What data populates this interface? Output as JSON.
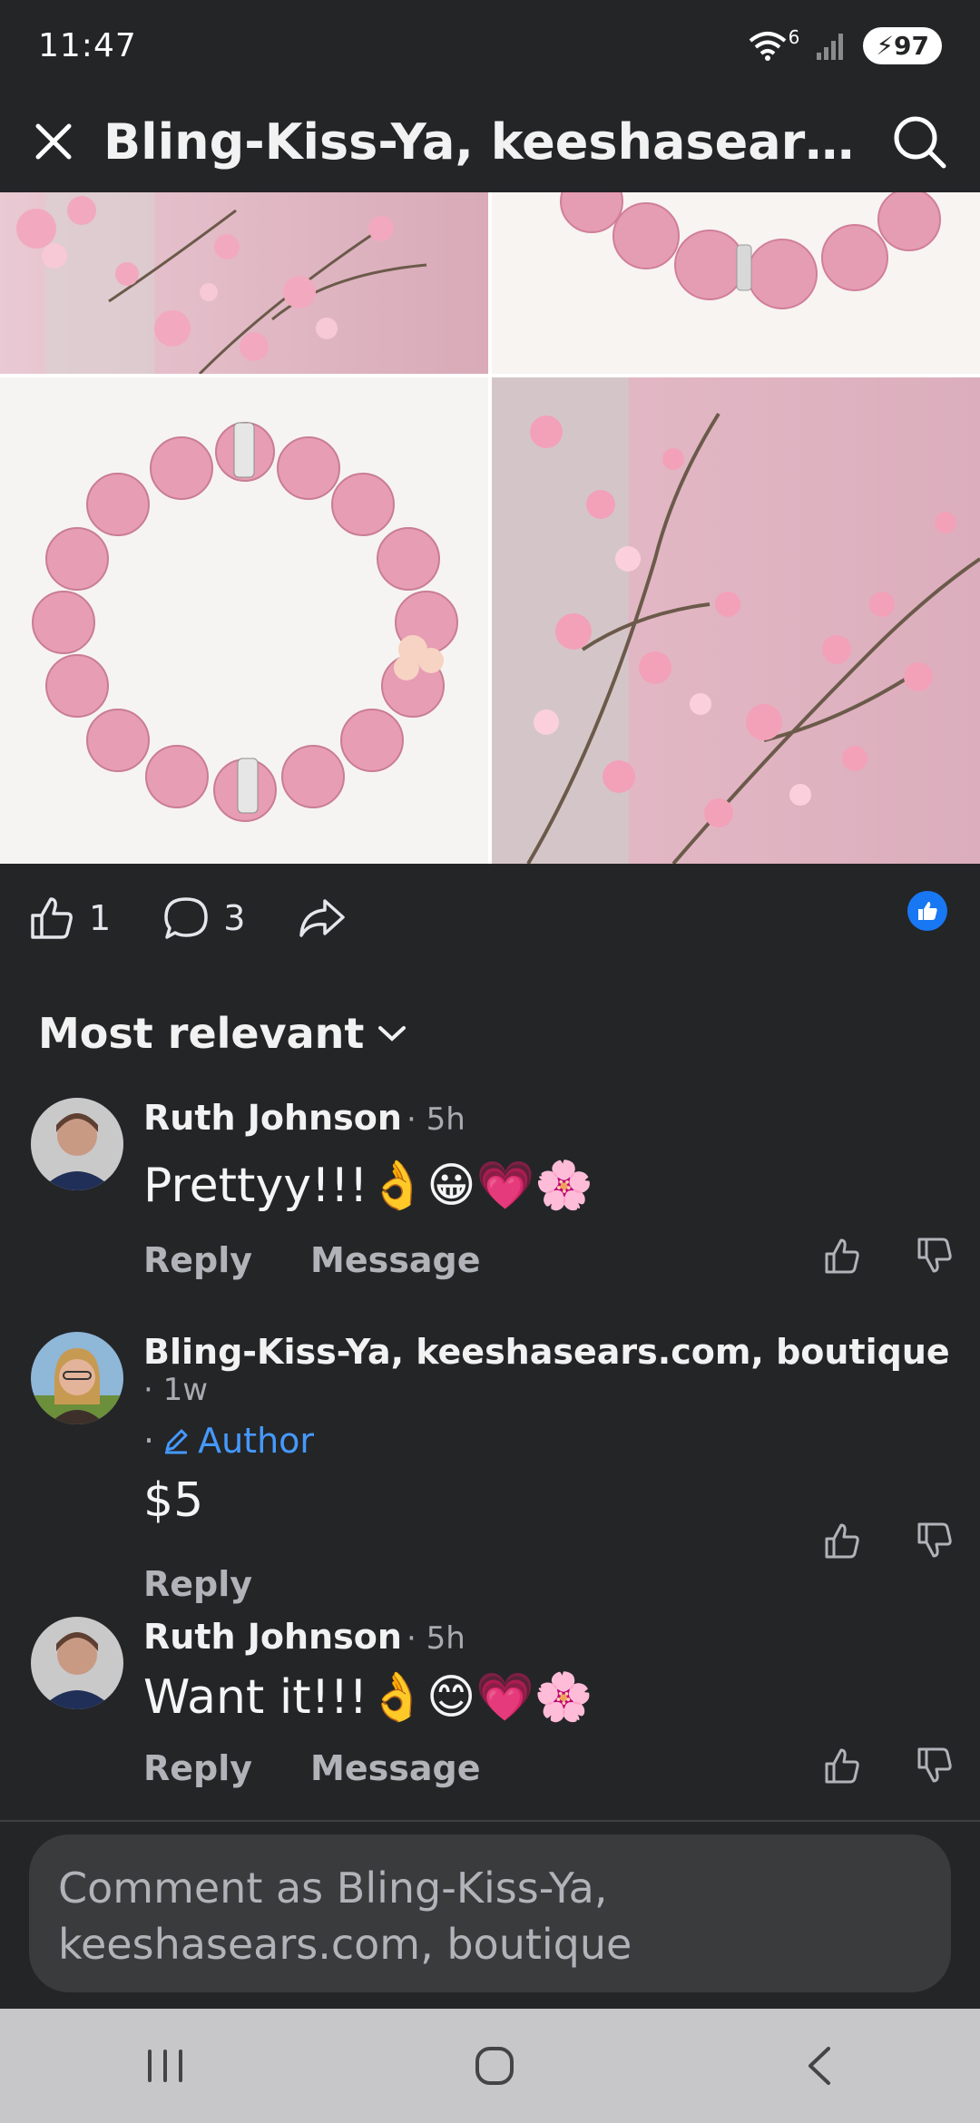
{
  "status": {
    "time": "11:47",
    "battery": "97",
    "wifi_badge": "6"
  },
  "header": {
    "title": "Bling-Kiss-Ya, keeshasears.com,...",
    "close_icon": "close-icon",
    "search_icon": "search-icon"
  },
  "post_actions": {
    "likes": "1",
    "comments": "3"
  },
  "sort": {
    "label": "Most relevant"
  },
  "comments": [
    {
      "name": "Ruth Johnson",
      "time": "· 5h",
      "text": "Prettyy!!!👌😀💗🌸",
      "reply": "Reply",
      "message": "Message"
    },
    {
      "name": "Bling-Kiss-Ya, keeshasears.com, boutique",
      "time": "· 1w",
      "badge": "Author",
      "text": "$5",
      "reply": "Reply"
    },
    {
      "name": "Ruth Johnson",
      "time": "· 5h",
      "text": "Want it!!!👌😊💗🌸",
      "reply": "Reply",
      "message": "Message"
    }
  ],
  "composer": {
    "placeholder": "Comment as Bling-Kiss-Ya, keeshasears.com, boutique"
  },
  "colors": {
    "background": "#242527",
    "accent": "#1877f2",
    "author": "#4599ff"
  }
}
